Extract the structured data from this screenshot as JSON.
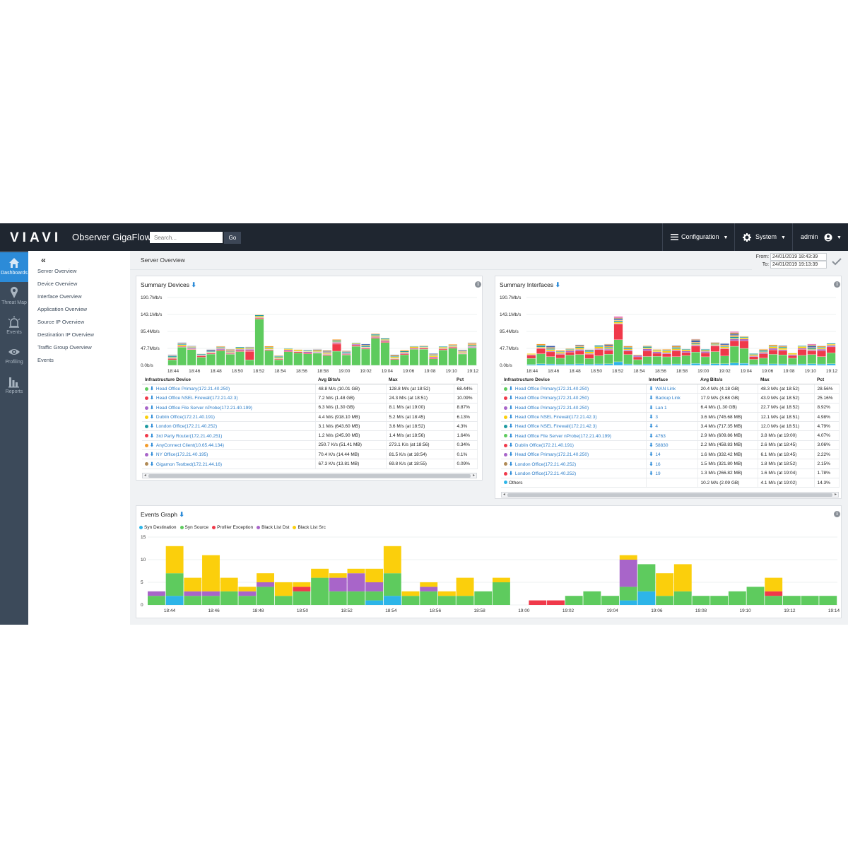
{
  "header": {
    "logo": "VIAVI",
    "app_title": "Observer GigaFlow",
    "search_placeholder": "Search...",
    "go_label": "Go",
    "configuration": "Configuration",
    "system": "System",
    "user": "admin"
  },
  "sidebar": {
    "items": [
      {
        "label": "Dashboards",
        "icon": "home-icon",
        "active": true
      },
      {
        "label": "Threat Map",
        "icon": "map-pin-icon",
        "active": false
      },
      {
        "label": "Events",
        "icon": "alarm-icon",
        "active": false
      },
      {
        "label": "Profiling",
        "icon": "eye-icon",
        "active": false
      },
      {
        "label": "Reports",
        "icon": "bar-chart-icon",
        "active": false
      }
    ]
  },
  "subnav": {
    "collapse_glyph": "«",
    "items": [
      "Server Overview",
      "Device Overview",
      "Interface Overview",
      "Application Overview",
      "Source IP Overview",
      "Destination IP Overview",
      "Traffic Group Overview",
      "Events"
    ]
  },
  "main": {
    "page_title": "Server Overview",
    "from_label": "From:",
    "from_value": "24/01/2019 18:43:39",
    "to_label": "To:",
    "to_value": "24/01/2019 19:13:39"
  },
  "colors": {
    "green": "#5ecb5e",
    "red": "#f0394a",
    "yellow": "#fbcf0c",
    "purple": "#a865c9",
    "blue": "#2db5e8",
    "orange": "#f39c2c",
    "teal": "#1f9aa0",
    "brown": "#b08a56",
    "navy": "#3a5dae",
    "pink": "#e866a9"
  },
  "summary_devices": {
    "title": "Summary Devices",
    "y_ticks": [
      "190.7Mb/s",
      "143.1Mb/s",
      "95.4Mb/s",
      "47.7Mb/s",
      "0.0b/s"
    ],
    "x_ticks": [
      "18:44",
      "18:46",
      "18:48",
      "18:50",
      "18:52",
      "18:54",
      "18:56",
      "18:58",
      "19:00",
      "19:02",
      "19:04",
      "19:06",
      "19:08",
      "19:10",
      "19:12"
    ],
    "columns": [
      "Infrastructure Device",
      "Avg Bits/s",
      "Max",
      "Pct"
    ],
    "rows": [
      {
        "color": "#5ecb5e",
        "name": "Head Office Primary(172.21.40.250)",
        "avg": "48.8 M/s (10.01 GB)",
        "max": "128.8 M/s (at 18:52)",
        "pct": "68.44%"
      },
      {
        "color": "#f0394a",
        "name": "Head Office NSEL Firewall(172.21.42.3)",
        "avg": "7.2 M/s (1.48 GB)",
        "max": "24.3 M/s (at 18:51)",
        "pct": "10.09%"
      },
      {
        "color": "#a865c9",
        "name": "Head Office File Server nProbe(172.21.40.199)",
        "avg": "6.3 M/s (1.30 GB)",
        "max": "8.1 M/s (at 19:00)",
        "pct": "8.87%"
      },
      {
        "color": "#fbcf0c",
        "name": "Dublin Office(172.21.40.191)",
        "avg": "4.4 M/s (918.10 MB)",
        "max": "5.2 M/s (at 18:45)",
        "pct": "6.13%"
      },
      {
        "color": "#1f9aa0",
        "name": "London Office(172.21.40.252)",
        "avg": "3.1 M/s (643.60 MB)",
        "max": "3.6 M/s (at 18:52)",
        "pct": "4.3%"
      },
      {
        "color": "#f0394a",
        "name": "3rd Party Router(172.21.40.251)",
        "avg": "1.2 M/s (245.90 MB)",
        "max": "1.4 M/s (at 18:56)",
        "pct": "1.64%"
      },
      {
        "color": "#f39c2c",
        "name": "AnyConnect Client(10.65.44.134)",
        "avg": "250.7 K/s (51.41 MB)",
        "max": "273.1 K/s (at 18:56)",
        "pct": "0.34%"
      },
      {
        "color": "#a865c9",
        "name": "NY Office(172.21.40.195)",
        "avg": "70.4 K/s (14.44 MB)",
        "max": "81.5 K/s (at 18:54)",
        "pct": "0.1%"
      },
      {
        "color": "#b08a56",
        "name": "Gigamon Testbed(172.21.44.16)",
        "avg": "67.3 K/s (13.81 MB)",
        "max": "69.8 K/s (at 18:55)",
        "pct": "0.09%"
      }
    ]
  },
  "summary_interfaces": {
    "title": "Summary Interfaces",
    "y_ticks": [
      "190.7Mb/s",
      "143.1Mb/s",
      "95.4Mb/s",
      "47.7Mb/s",
      "0.0b/s"
    ],
    "x_ticks": [
      "18:44",
      "18:46",
      "18:48",
      "18:50",
      "18:52",
      "18:54",
      "18:56",
      "18:58",
      "19:00",
      "19:02",
      "19:04",
      "19:06",
      "19:08",
      "19:10",
      "19:12"
    ],
    "columns": [
      "Infrastructure Device",
      "Interface",
      "Avg Bits/s",
      "Max",
      "Pct"
    ],
    "rows": [
      {
        "color": "#5ecb5e",
        "name": "Head Office Primary(172.21.40.250)",
        "iface": "WAN Link",
        "avg": "20.4 M/s (4.18 GB)",
        "max": "48.3 M/s (at 18:52)",
        "pct": "28.56%"
      },
      {
        "color": "#f0394a",
        "name": "Head Office Primary(172.21.40.250)",
        "iface": "Backup Link",
        "avg": "17.9 M/s (3.68 GB)",
        "max": "43.9 M/s (at 18:52)",
        "pct": "25.16%"
      },
      {
        "color": "#a865c9",
        "name": "Head Office Primary(172.21.40.250)",
        "iface": "Lan 1",
        "avg": "6.4 M/s (1.30 GB)",
        "max": "22.7 M/s (at 18:52)",
        "pct": "8.92%"
      },
      {
        "color": "#fbcf0c",
        "name": "Head Office NSEL Firewall(172.21.42.3)",
        "iface": "3",
        "avg": "3.6 M/s (745.68 MB)",
        "max": "12.1 M/s (at 18:51)",
        "pct": "4.98%"
      },
      {
        "color": "#1f9aa0",
        "name": "Head Office NSEL Firewall(172.21.42.3)",
        "iface": "4",
        "avg": "3.4 M/s (717.35 MB)",
        "max": "12.0 M/s (at 18:51)",
        "pct": "4.79%"
      },
      {
        "color": "#5ecb5e",
        "name": "Head Office File Server nProbe(172.21.40.199)",
        "iface": "4763",
        "avg": "2.9 M/s (609.86 MB)",
        "max": "3.8 M/s (at 19:00)",
        "pct": "4.07%"
      },
      {
        "color": "#f0394a",
        "name": "Dublin Office(172.21.40.191)",
        "iface": "58830",
        "avg": "2.2 M/s (458.83 MB)",
        "max": "2.6 M/s (at 18:45)",
        "pct": "3.06%"
      },
      {
        "color": "#a865c9",
        "name": "Head Office Primary(172.21.40.250)",
        "iface": "14",
        "avg": "1.6 M/s (332.42 MB)",
        "max": "6.1 M/s (at 18:45)",
        "pct": "2.22%"
      },
      {
        "color": "#b08a56",
        "name": "London Office(172.21.40.252)",
        "iface": "16",
        "avg": "1.5 M/s (321.80 MB)",
        "max": "1.8 M/s (at 18:52)",
        "pct": "2.15%"
      },
      {
        "color": "#f0394a",
        "name": "London Office(172.21.40.252)",
        "iface": "19",
        "avg": "1.3 M/s (266.82 MB)",
        "max": "1.6 M/s (at 19:04)",
        "pct": "1.78%"
      },
      {
        "color": "#2db5e8",
        "name": "Others",
        "iface": "",
        "avg": "10.2 M/s (2.09 GB)",
        "max": "4.1 M/s (at 19:02)",
        "pct": "14.3%",
        "plain": true
      }
    ]
  },
  "events_graph": {
    "title": "Events Graph",
    "legend": [
      {
        "name": "Syn Destination",
        "color": "#2db5e8"
      },
      {
        "name": "Syn Source",
        "color": "#5ecb5e"
      },
      {
        "name": "Profiler Exception",
        "color": "#f0394a"
      },
      {
        "name": "Black List Dst",
        "color": "#a865c9"
      },
      {
        "name": "Black List Src",
        "color": "#fbcf0c"
      }
    ],
    "y_ticks": [
      "15",
      "10",
      "5",
      "0"
    ],
    "x_ticks": [
      "18:44",
      "18:46",
      "18:48",
      "18:50",
      "18:52",
      "18:54",
      "18:56",
      "18:58",
      "19:00",
      "19:02",
      "19:04",
      "19:06",
      "19:08",
      "19:10",
      "19:12",
      "19:14"
    ]
  },
  "chart_data": [
    {
      "type": "bar",
      "title": "Summary Devices",
      "stacked": true,
      "ylim": [
        0,
        190.7
      ],
      "y_unit": "Mb/s",
      "x_ticks": [
        "18:44",
        "18:46",
        "18:48",
        "18:50",
        "18:52",
        "18:54",
        "18:56",
        "18:58",
        "19:00",
        "19:02",
        "19:04",
        "19:06",
        "19:08",
        "19:10",
        "19:12"
      ],
      "series_colors": [
        "#5ecb5e",
        "#f0394a",
        "#a865c9",
        "#fbcf0c",
        "#1f9aa0",
        "#f39c2c",
        "#3a5dae",
        "#b08a56"
      ],
      "totals": [
        30,
        64,
        55,
        33,
        45,
        54,
        45,
        52,
        52,
        143,
        54,
        28,
        48,
        45,
        44,
        46,
        42,
        73,
        42,
        64,
        60,
        90,
        77,
        30,
        43,
        54,
        55,
        33,
        53,
        59,
        44,
        64
      ],
      "seconds": [
        0,
        0,
        0,
        0,
        0,
        0,
        0,
        0,
        24,
        0,
        0,
        0,
        0,
        0,
        0,
        0,
        0,
        20,
        0,
        0,
        0,
        0,
        0,
        0,
        0,
        0,
        0,
        0,
        0,
        0,
        0,
        0
      ]
    },
    {
      "type": "bar",
      "title": "Summary Interfaces",
      "stacked": true,
      "ylim": [
        0,
        190.7
      ],
      "y_unit": "Mb/s",
      "x_ticks": [
        "18:44",
        "18:46",
        "18:48",
        "18:50",
        "18:52",
        "18:54",
        "18:56",
        "18:58",
        "19:00",
        "19:02",
        "19:04",
        "19:06",
        "19:08",
        "19:10",
        "19:12"
      ],
      "series_colors": [
        "#2db5e8",
        "#5ecb5e",
        "#f0394a",
        "#a865c9",
        "#fbcf0c",
        "#1f9aa0",
        "#f39c2c",
        "#3a5dae",
        "#b08a56",
        "#e866a9"
      ],
      "totals": [
        33,
        60,
        55,
        42,
        48,
        58,
        45,
        57,
        60,
        143,
        55,
        30,
        55,
        45,
        45,
        56,
        46,
        74,
        45,
        65,
        62,
        95,
        82,
        33,
        45,
        58,
        56,
        35,
        55,
        60,
        55,
        62
      ]
    },
    {
      "type": "bar",
      "title": "Events Graph",
      "stacked": true,
      "ylim": [
        0,
        15
      ],
      "x_ticks": [
        "18:44",
        "18:46",
        "18:48",
        "18:50",
        "18:52",
        "18:54",
        "18:56",
        "18:58",
        "19:00",
        "19:02",
        "19:04",
        "19:06",
        "19:08",
        "19:10",
        "19:12",
        "19:14"
      ],
      "series": [
        {
          "name": "Syn Destination",
          "values": [
            0,
            2,
            0,
            0,
            0,
            0,
            0,
            0,
            0,
            0,
            0,
            0,
            1,
            2,
            0,
            0,
            0,
            0,
            0,
            0,
            0,
            0,
            0,
            0,
            0,
            0,
            1,
            3,
            0,
            0,
            0,
            0,
            0,
            0,
            0,
            0,
            0,
            0
          ]
        },
        {
          "name": "Syn Source",
          "values": [
            2,
            5,
            2,
            2,
            3,
            2,
            4,
            2,
            3,
            6,
            3,
            3,
            2,
            5,
            2,
            3,
            2,
            2,
            3,
            5,
            0,
            0,
            0,
            2,
            3,
            2,
            3,
            6,
            2,
            3,
            2,
            2,
            3,
            4,
            2,
            2,
            2,
            2
          ]
        },
        {
          "name": "Profiler Exception",
          "values": [
            0,
            0,
            0,
            0,
            0,
            0,
            0,
            0,
            1,
            0,
            0,
            0,
            0,
            0,
            0,
            0,
            0,
            0,
            0,
            0,
            0,
            1,
            1,
            0,
            0,
            0,
            0,
            0,
            0,
            0,
            0,
            0,
            0,
            0,
            1,
            0,
            0,
            0
          ]
        },
        {
          "name": "Black List Dst",
          "values": [
            1,
            0,
            1,
            1,
            0,
            1,
            1,
            0,
            0,
            0,
            3,
            4,
            2,
            0,
            0,
            1,
            0,
            0,
            0,
            0,
            0,
            0,
            0,
            0,
            0,
            0,
            6,
            0,
            0,
            0,
            0,
            0,
            0,
            0,
            0,
            0,
            0,
            0
          ]
        },
        {
          "name": "Black List Src",
          "values": [
            0,
            6,
            3,
            8,
            3,
            1,
            2,
            3,
            1,
            2,
            1,
            1,
            3,
            6,
            1,
            1,
            1,
            4,
            0,
            1,
            0,
            0,
            0,
            0,
            0,
            0,
            1,
            0,
            5,
            6,
            0,
            0,
            0,
            0,
            3,
            0,
            0,
            0
          ]
        }
      ]
    }
  ]
}
